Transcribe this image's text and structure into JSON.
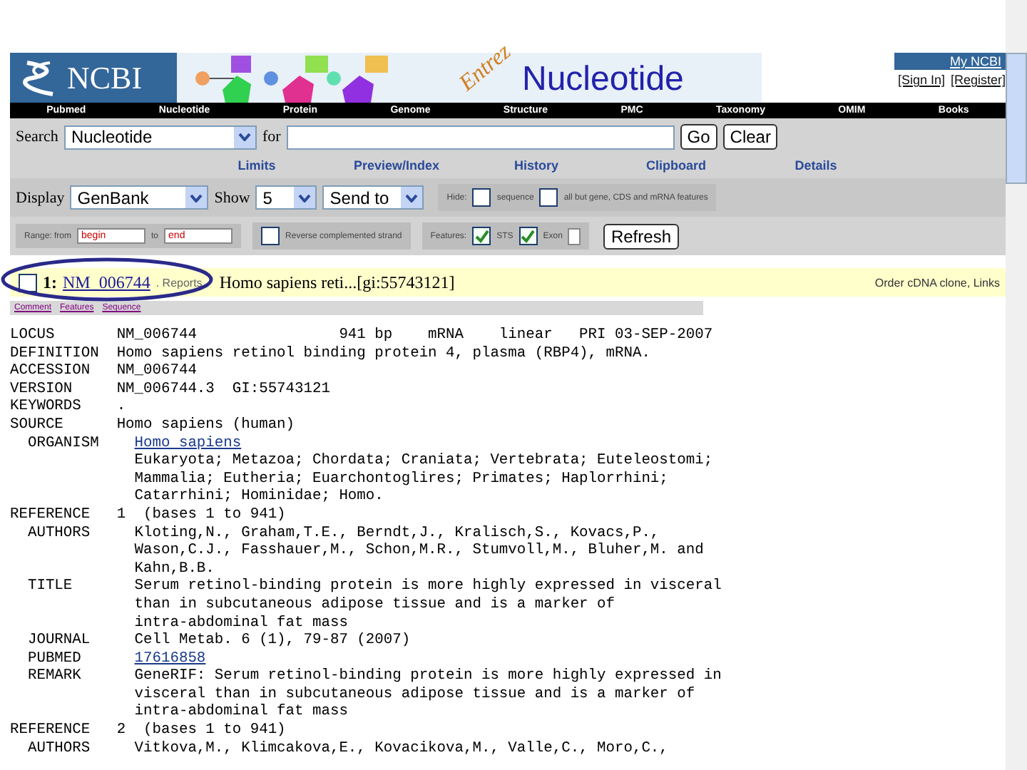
{
  "header": {
    "logo": "NCBI",
    "banner_kicker": "Entrez",
    "banner_title": "Nucleotide",
    "account": "My NCBI",
    "account_links": [
      "[Sign In]",
      "[Register]"
    ]
  },
  "nav": [
    "Pubmed",
    "Nucleotide",
    "Protein",
    "Genome",
    "Structure",
    "PMC",
    "Taxonomy",
    "OMIM",
    "Books"
  ],
  "search": {
    "label": "Search",
    "database": "Nucleotide",
    "for_label": "for",
    "go": "Go",
    "clear": "Clear"
  },
  "links": [
    "Limits",
    "Preview/Index",
    "History",
    "Clipboard",
    "Details"
  ],
  "display": {
    "label": "Display",
    "format": "GenBank",
    "show_label": "Show",
    "show": "5",
    "send_to": "Send to",
    "hide_label": "Hide:",
    "hide_options": [
      {
        "label": "sequence",
        "checked": false
      },
      {
        "label": "all but gene, CDS and mRNA features",
        "checked": false
      }
    ],
    "range_label": "Range: from",
    "range_from": "begin",
    "to_label": "to",
    "range_to": "end",
    "reverse": {
      "label": "Reverse complemented strand",
      "checked": false
    },
    "features_label": "Features:",
    "features": [
      {
        "label": "STS",
        "checked": true
      },
      {
        "label": "Exon",
        "checked": true
      }
    ],
    "refresh": "Refresh"
  },
  "result": {
    "checked": false,
    "index": "1:",
    "accession": "NM_006744",
    "reports": ". Reports",
    "summary": "Homo sapiens reti...[gi:55743121]",
    "right_links": "Order cDNA clone, Links",
    "sub_links": [
      "Comment",
      "Features",
      "Sequence"
    ]
  },
  "record": [
    {
      "label": "LOCUS",
      "lines": [
        {
          "kind": "text",
          "text": "NM_006744                941 bp    mRNA    linear   PRI 03-SEP-2007"
        }
      ]
    },
    {
      "label": "DEFINITION",
      "lines": [
        {
          "kind": "text",
          "text": "Homo sapiens retinol binding protein 4, plasma (RBP4), mRNA."
        }
      ]
    },
    {
      "label": "ACCESSION",
      "lines": [
        {
          "kind": "text",
          "text": "NM_006744"
        }
      ]
    },
    {
      "label": "VERSION",
      "lines": [
        {
          "kind": "text",
          "text": "NM_006744.3  GI:55743121"
        }
      ]
    },
    {
      "label": "KEYWORDS",
      "lines": [
        {
          "kind": "text",
          "text": "."
        }
      ]
    },
    {
      "label": "SOURCE",
      "lines": [
        {
          "kind": "text",
          "text": "Homo sapiens (human)"
        }
      ],
      "children": [
        {
          "label": "ORGANISM",
          "lines": [
            {
              "kind": "link",
              "text": "Homo sapiens"
            },
            {
              "kind": "text",
              "text": "Eukaryota; Metazoa; Chordata; Craniata; Vertebrata; Euteleostomi;"
            },
            {
              "kind": "text",
              "text": "Mammalia; Eutheria; Euarchontoglires; Primates; Haplorrhini;"
            },
            {
              "kind": "text",
              "text": "Catarrhini; Hominidae; Homo."
            }
          ]
        }
      ]
    },
    {
      "label": "REFERENCE",
      "lines": [
        {
          "kind": "text",
          "text": "1  (bases 1 to 941)"
        }
      ],
      "children": [
        {
          "label": "AUTHORS",
          "lines": [
            {
              "kind": "text",
              "text": "Kloting,N., Graham,T.E., Berndt,J., Kralisch,S., Kovacs,P.,"
            },
            {
              "kind": "text",
              "text": "Wason,C.J., Fasshauer,M., Schon,M.R., Stumvoll,M., Bluher,M. and"
            },
            {
              "kind": "text",
              "text": "Kahn,B.B."
            }
          ]
        },
        {
          "label": "TITLE",
          "lines": [
            {
              "kind": "text",
              "text": "Serum retinol-binding protein is more highly expressed in visceral"
            },
            {
              "kind": "text",
              "text": "than in subcutaneous adipose tissue and is a marker of"
            },
            {
              "kind": "text",
              "text": "intra-abdominal fat mass"
            }
          ]
        },
        {
          "label": "JOURNAL",
          "lines": [
            {
              "kind": "text",
              "text": "Cell Metab. 6 (1), 79-87 (2007)"
            }
          ]
        },
        {
          "label": "PUBMED",
          "lines": [
            {
              "kind": "link",
              "text": "17616858"
            }
          ]
        },
        {
          "label": "REMARK",
          "lines": [
            {
              "kind": "text",
              "text": "GeneRIF: Serum retinol-binding protein is more highly expressed in"
            },
            {
              "kind": "text",
              "text": "visceral than in subcutaneous adipose tissue and is a marker of"
            },
            {
              "kind": "text",
              "text": "intra-abdominal fat mass"
            }
          ]
        }
      ]
    },
    {
      "label": "REFERENCE",
      "lines": [
        {
          "kind": "text",
          "text": "2  (bases 1 to 941)"
        }
      ],
      "children": [
        {
          "label": "AUTHORS",
          "lines": [
            {
              "kind": "text",
              "text": "Vitkova,M., Klimcakova,E., Kovacikova,M., Valle,C., Moro,C.,"
            }
          ]
        }
      ]
    }
  ]
}
